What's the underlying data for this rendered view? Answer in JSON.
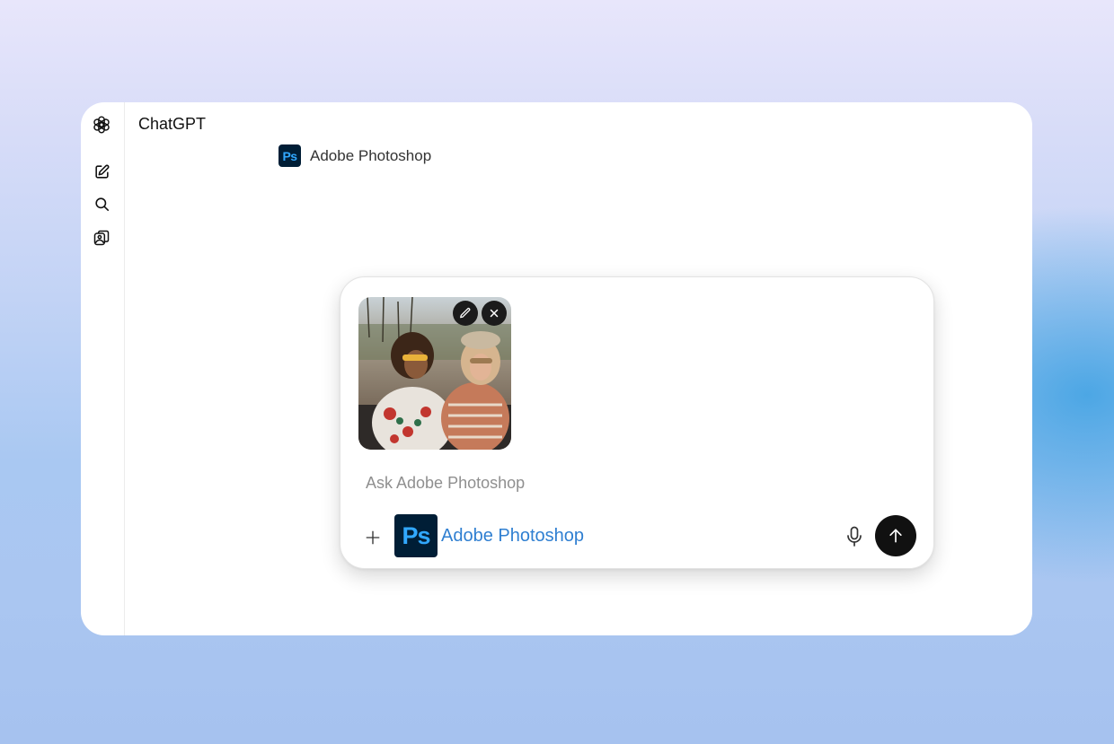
{
  "app": {
    "title": "ChatGPT"
  },
  "sidebar": {
    "items": [
      {
        "name": "openai-logo-icon"
      },
      {
        "name": "new-chat-icon"
      },
      {
        "name": "search-icon"
      },
      {
        "name": "library-icon"
      }
    ]
  },
  "header": {
    "app_name": "Adobe Photoshop",
    "icon_text": "Ps"
  },
  "composer": {
    "placeholder": "Ask Adobe Photoshop",
    "value": "",
    "attachment": {
      "type": "photo",
      "actions": [
        "edit-icon",
        "close-icon"
      ]
    },
    "app_chip": {
      "icon_text": "Ps",
      "label": "Adobe Photoshop"
    },
    "add_icon": "plus-icon",
    "mic_icon": "microphone-icon",
    "send_icon": "arrow-up-icon"
  },
  "colors": {
    "photoshop_bg": "#001e36",
    "photoshop_text": "#31a8ff",
    "chip_label": "#2f7fd1",
    "send_button": "#111111"
  }
}
